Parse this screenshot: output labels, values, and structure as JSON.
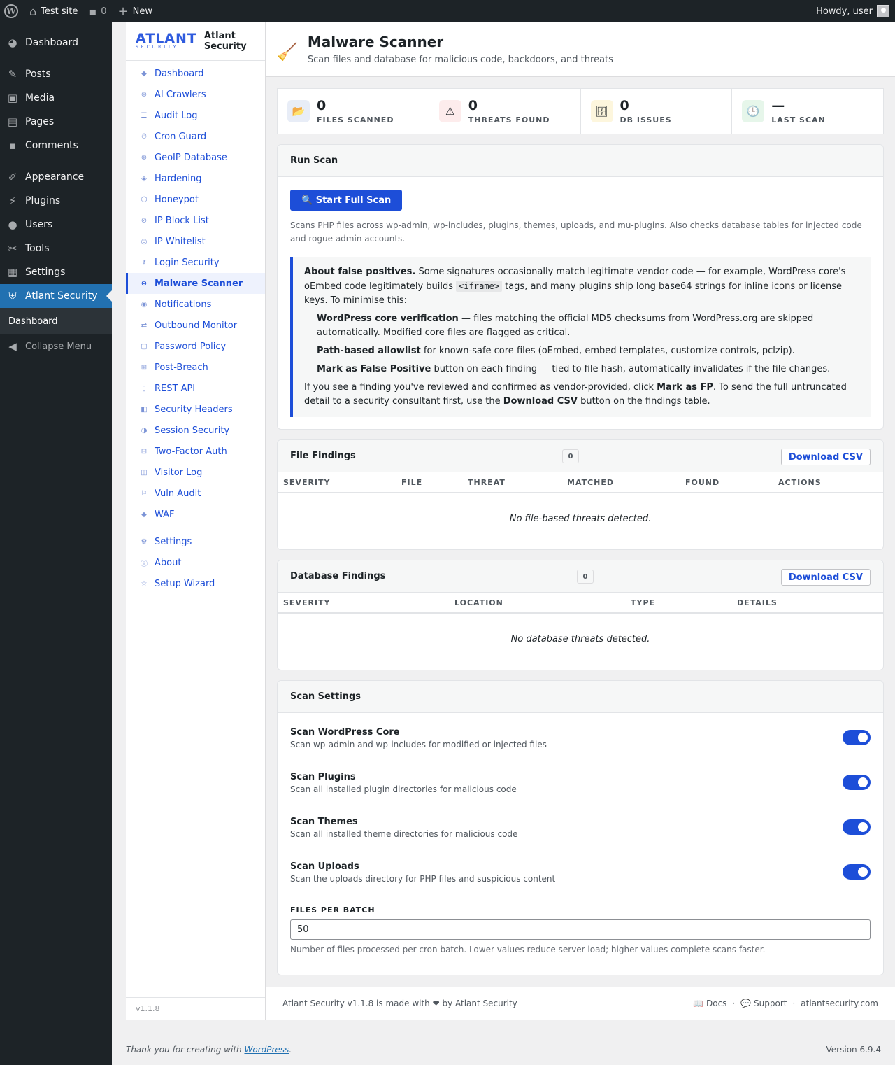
{
  "adminbar": {
    "site_name": "Test site",
    "comments_count": "0",
    "new_label": "New",
    "howdy": "Howdy, user"
  },
  "adminmenu": {
    "items": [
      {
        "label": "Dashboard",
        "icon": "dashboard-icon"
      },
      {
        "label": "Posts",
        "icon": "pin-icon"
      },
      {
        "label": "Media",
        "icon": "media-icon"
      },
      {
        "label": "Pages",
        "icon": "pages-icon"
      },
      {
        "label": "Comments",
        "icon": "comments-icon"
      },
      {
        "label": "Appearance",
        "icon": "brush-icon"
      },
      {
        "label": "Plugins",
        "icon": "plug-icon"
      },
      {
        "label": "Users",
        "icon": "user-icon"
      },
      {
        "label": "Tools",
        "icon": "wrench-icon"
      },
      {
        "label": "Settings",
        "icon": "settings-icon"
      },
      {
        "label": "Atlant Security",
        "icon": "shield-icon"
      }
    ],
    "submenu": [
      "Dashboard"
    ],
    "collapse": "Collapse Menu"
  },
  "plugin": {
    "logo_big": "ATLANT",
    "logo_small": "SECURITY",
    "name_line1": "Atlant",
    "name_line2": "Security",
    "nav": [
      {
        "label": "Dashboard",
        "glyph": "◆"
      },
      {
        "label": "AI Crawlers",
        "glyph": "⊛"
      },
      {
        "label": "Audit Log",
        "glyph": "☰"
      },
      {
        "label": "Cron Guard",
        "glyph": "⏱"
      },
      {
        "label": "GeoIP Database",
        "glyph": "⊕"
      },
      {
        "label": "Hardening",
        "glyph": "◈"
      },
      {
        "label": "Honeypot",
        "glyph": "⬡"
      },
      {
        "label": "IP Block List",
        "glyph": "⊘"
      },
      {
        "label": "IP Whitelist",
        "glyph": "◎"
      },
      {
        "label": "Login Security",
        "glyph": "⚷"
      },
      {
        "label": "Malware Scanner",
        "glyph": "⊙"
      },
      {
        "label": "Notifications",
        "glyph": "◉"
      },
      {
        "label": "Outbound Monitor",
        "glyph": "⇄"
      },
      {
        "label": "Password Policy",
        "glyph": "▢"
      },
      {
        "label": "Post-Breach",
        "glyph": "⊞"
      },
      {
        "label": "REST API",
        "glyph": "▯"
      },
      {
        "label": "Security Headers",
        "glyph": "◧"
      },
      {
        "label": "Session Security",
        "glyph": "◑"
      },
      {
        "label": "Two-Factor Auth",
        "glyph": "⊟"
      },
      {
        "label": "Visitor Log",
        "glyph": "◫"
      },
      {
        "label": "Vuln Audit",
        "glyph": "⚐"
      },
      {
        "label": "WAF",
        "glyph": "◆"
      }
    ],
    "nav_bottom": [
      {
        "label": "Settings",
        "glyph": "⚙"
      },
      {
        "label": "About",
        "glyph": "ⓘ"
      },
      {
        "label": "Setup Wizard",
        "glyph": "☆"
      }
    ],
    "version": "v1.1.8"
  },
  "page": {
    "title": "Malware Scanner",
    "subtitle": "Scan files and database for malicious code, backdoors, and threats"
  },
  "stats": [
    {
      "value": "0",
      "label": "FILES SCANNED",
      "icon": "folder-icon",
      "glyph": "📂",
      "bg": "#e8edf7"
    },
    {
      "value": "0",
      "label": "THREATS FOUND",
      "icon": "warning-icon",
      "glyph": "⚠",
      "bg": "#fdecec"
    },
    {
      "value": "0",
      "label": "DB ISSUES",
      "icon": "database-icon",
      "glyph": "🗄",
      "bg": "#fdf6dd"
    },
    {
      "value": "—",
      "label": "LAST SCAN",
      "icon": "clock-icon",
      "glyph": "🕒",
      "bg": "#e6f6ea"
    }
  ],
  "run_scan": {
    "header": "Run Scan",
    "button": "🔍 Start Full Scan",
    "description": "Scans PHP files across wp-admin, wp-includes, plugins, themes, uploads, and mu-plugins. Also checks database tables for injected code and rogue admin accounts.",
    "note": {
      "intro_bold": "About false positives.",
      "intro_1": " Some signatures occasionally match legitimate vendor code — for example, WordPress core's oEmbed code legitimately builds ",
      "code": "<iframe>",
      "intro_2": " tags, and many plugins ship long base64 strings for inline icons or license keys. To minimise this:",
      "b1_bold": "WordPress core verification",
      "b1_text": " — files matching the official MD5 checksums from WordPress.org are skipped automatically. Modified core files are flagged as critical.",
      "b2_bold": "Path-based allowlist",
      "b2_text": " for known-safe core files (oEmbed, embed templates, customize controls, pclzip).",
      "b3_bold": "Mark as False Positive",
      "b3_text": " button on each finding — tied to file hash, automatically invalidates if the file changes.",
      "outro_1": "If you see a finding you've reviewed and confirmed as vendor-provided, click ",
      "outro_bold1": "Mark as FP",
      "outro_2": ". To send the full untruncated detail to a security consultant first, use the ",
      "outro_bold2": "Download CSV",
      "outro_3": " button on the findings table."
    }
  },
  "file_findings": {
    "header": "File Findings",
    "count": "0",
    "download": "Download CSV",
    "columns": [
      "SEVERITY",
      "FILE",
      "THREAT",
      "MATCHED",
      "FOUND",
      "ACTIONS"
    ],
    "empty": "No file-based threats detected."
  },
  "db_findings": {
    "header": "Database Findings",
    "count": "0",
    "download": "Download CSV",
    "columns": [
      "SEVERITY",
      "LOCATION",
      "TYPE",
      "DETAILS"
    ],
    "empty": "No database threats detected."
  },
  "scan_settings": {
    "header": "Scan Settings",
    "toggles": [
      {
        "title": "Scan WordPress Core",
        "desc": "Scan wp-admin and wp-includes for modified or injected files",
        "on": true
      },
      {
        "title": "Scan Plugins",
        "desc": "Scan all installed plugin directories for malicious code",
        "on": true
      },
      {
        "title": "Scan Themes",
        "desc": "Scan all installed theme directories for malicious code",
        "on": true
      },
      {
        "title": "Scan Uploads",
        "desc": "Scan the uploads directory for PHP files and suspicious content",
        "on": true
      }
    ],
    "batch_label": "FILES PER BATCH",
    "batch_value": "50",
    "batch_help": "Number of files processed per cron batch. Lower values reduce server load; higher values complete scans faster."
  },
  "plugin_footer": {
    "made": "Atlant Security v1.1.8 is made with ❤ by Atlant Security",
    "docs": "📖 Docs",
    "support": "💬 Support",
    "site": "atlantsecurity.com",
    "sep": "·"
  },
  "wp_footer": {
    "thanks_prefix": "Thank you for creating with ",
    "thanks_link": "WordPress",
    "thanks_suffix": ".",
    "version": "Version 6.9.4"
  }
}
